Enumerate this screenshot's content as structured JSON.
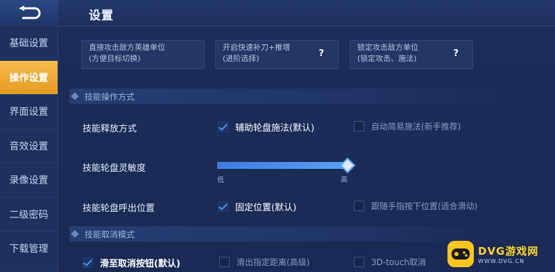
{
  "header": {
    "title": "设置"
  },
  "sidebar": {
    "items": [
      {
        "label": "基础设置"
      },
      {
        "label": "操作设置"
      },
      {
        "label": "界面设置"
      },
      {
        "label": "音效设置"
      },
      {
        "label": "录像设置"
      },
      {
        "label": "二级密码"
      },
      {
        "label": "下载管理"
      }
    ],
    "active_index": 1
  },
  "target_options": [
    {
      "line1": "直接攻击敌方英雄单位",
      "line2": "(方便目标切换)"
    },
    {
      "line1": "开启快速补刀+推塔",
      "line2": "(进阶选择)",
      "help": "?"
    },
    {
      "line1": "锁定攻击敌方单位",
      "line2": "(锁定攻击、施法)",
      "help": "?"
    }
  ],
  "section_skill_ops": {
    "title": "技能操作方式"
  },
  "cast_mode": {
    "label": "技能释放方式",
    "option_default": "辅助轮盘施法(默认)",
    "option_alt": "自动简易施法(新手推荐)",
    "checked_default": true,
    "checked_alt": false
  },
  "sensitivity": {
    "label": "技能轮盘灵敏度",
    "low": "低",
    "high": "高",
    "level": 1.0
  },
  "wheel_position": {
    "label": "技能轮盘呼出位置",
    "option_default": "固定位置(默认)",
    "option_alt": "跟随手指按下位置(适合滑动)",
    "checked_default": true,
    "checked_alt": false
  },
  "section_cancel": {
    "title": "技能取消模式"
  },
  "cancel_mode": {
    "option_default": "滑至取消按钮(默认)",
    "option_distance": "滑出指定距离(高级)",
    "option_3d": "3D-touch取消",
    "checked_default": true
  },
  "watermark": {
    "brand": "DVG游戏网",
    "url": "WWW.DVG.CN"
  },
  "colors": {
    "accent": "#f0a832",
    "check": "#3b8cf0",
    "slider": "#4a90e8"
  }
}
